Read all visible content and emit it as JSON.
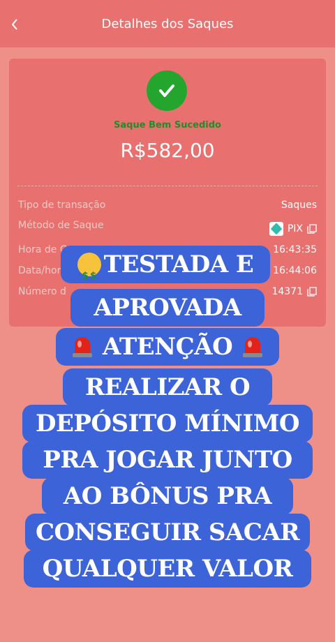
{
  "header": {
    "title": "Detalhes dos Saques",
    "back_icon": "chevron-left-icon"
  },
  "card": {
    "status_icon": "check-circle-icon",
    "status_text": "Saque Bem Sucedido",
    "amount": "R$582,00",
    "rows": [
      {
        "label": "Tipo de transação",
        "value": "Saques"
      },
      {
        "label": "Método de Saque",
        "value": "PIX",
        "icon": "pix-icon",
        "copy": true
      },
      {
        "label": "Hora de C",
        "value": "16:43:35"
      },
      {
        "label": "Data/hor",
        "value": "16:44:06"
      },
      {
        "label": "Número d",
        "value": "14371",
        "copy": true
      }
    ]
  },
  "promo": {
    "line1": "TESTADA E",
    "line2": "APROVADA",
    "line3": "ATENÇÃO",
    "line4": "REALIZAR O",
    "line5": "DEPÓSITO MÍNIMO",
    "line6": "PRA JOGAR JUNTO",
    "line7": "AO BÔNUS PRA",
    "line8": "CONSEGUIR SACAR",
    "line9": "QUALQUER VALOR"
  },
  "colors": {
    "background": "#ee9088",
    "header": "#e8706f",
    "success": "#24a52e",
    "banner": "#3c63d8",
    "pix": "#32bcad"
  }
}
